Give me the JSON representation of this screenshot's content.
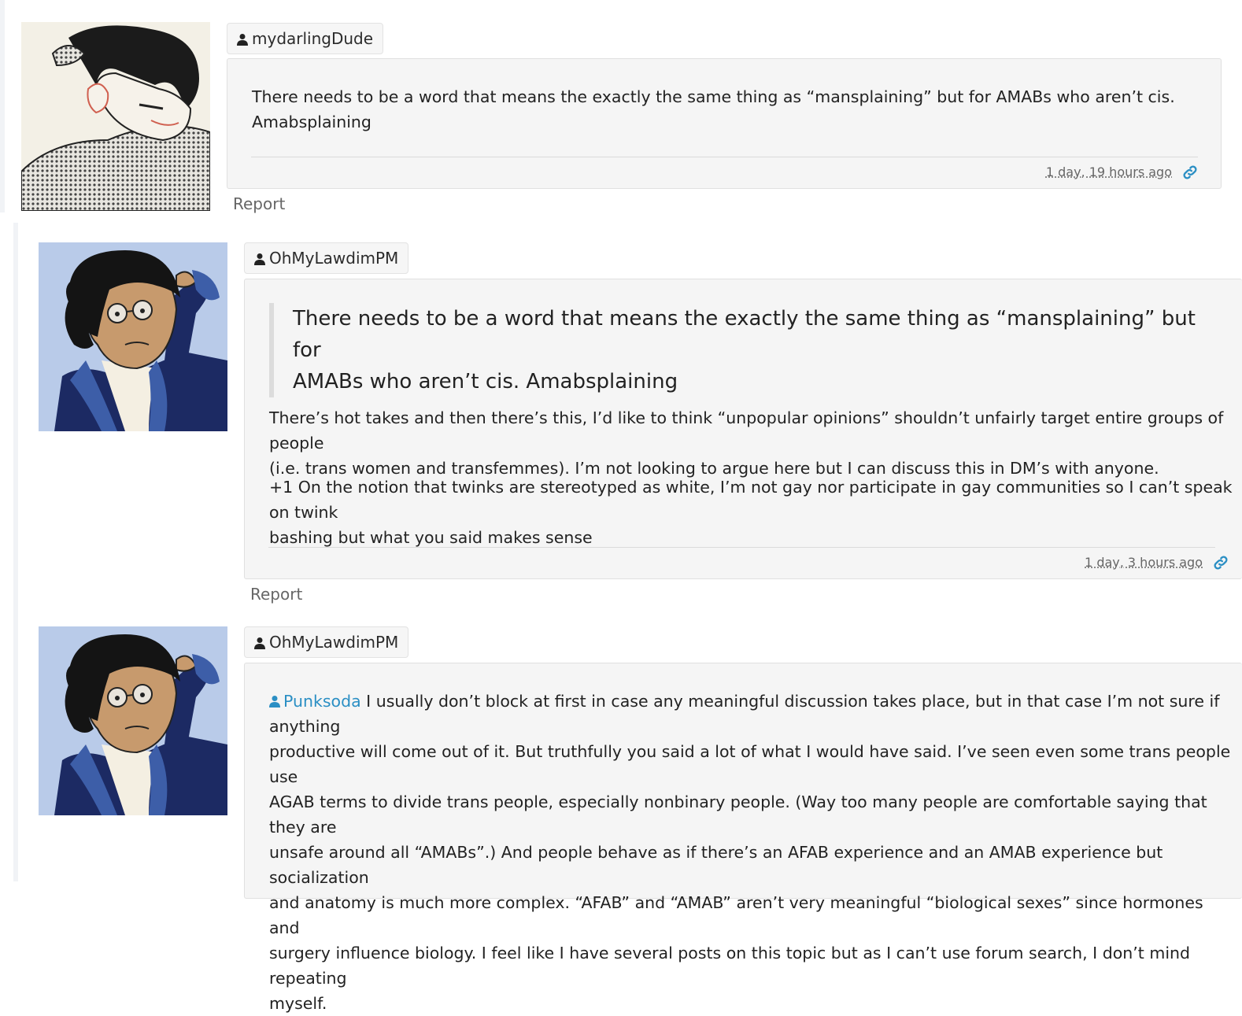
{
  "comments": [
    {
      "author": "mydarlingDude",
      "body_lines": [
        "There needs to be a word that means the exactly the same thing as “mansplaining” but for AMABs who aren’t cis.",
        "Amabsplaining"
      ],
      "timestamp": "1 day, 19 hours ago",
      "report_label": "Report"
    },
    {
      "author": "OhMyLawdimPM",
      "quote_lines": [
        "There needs to be a word that means the exactly the same thing as “mansplaining” but for",
        "AMABs who aren’t cis. Amabsplaining"
      ],
      "para1_lines": [
        "There’s hot takes and then there’s this, I’d like to think “unpopular opinions” shouldn’t unfairly target entire groups of people",
        "(i.e. trans women and transfemmes). I’m not looking to argue here but I can discuss this in DM’s with anyone."
      ],
      "para2_lines": [
        "+1 On the notion that twinks are stereotyped as white, I’m not gay nor participate in gay communities so I can’t speak on twink",
        "bashing but what you said makes sense"
      ],
      "timestamp": "1 day, 3 hours ago",
      "report_label": "Report"
    },
    {
      "author": "OhMyLawdimPM",
      "mention": "Punksoda",
      "body_lines": [
        " I usually don’t block at first in case any meaningful discussion takes place, but in that case I’m not sure if anything",
        "productive will come out of it. But truthfully you said a lot of what I would have said. I’ve seen even some trans people use",
        "AGAB terms to divide trans people, especially nonbinary people. (Way too many people are comfortable saying that they are",
        "unsafe around all “AMABs”.) And people behave as if there’s an AFAB experience and an AMAB experience but socialization",
        "and anatomy is much more complex. “AFAB” and “AMAB” aren’t very meaningful “biological sexes” since hormones and",
        "surgery influence biology. I feel like I have several posts on this topic but as I can’t use forum search, I don’t mind repeating",
        "myself."
      ]
    }
  ],
  "icons": {
    "author": "person-icon",
    "permalink": "link-icon"
  },
  "colors": {
    "mention": "#2b8fc4",
    "card_bg": "#f5f5f5",
    "avatar_bg": "#b9cbe9"
  }
}
